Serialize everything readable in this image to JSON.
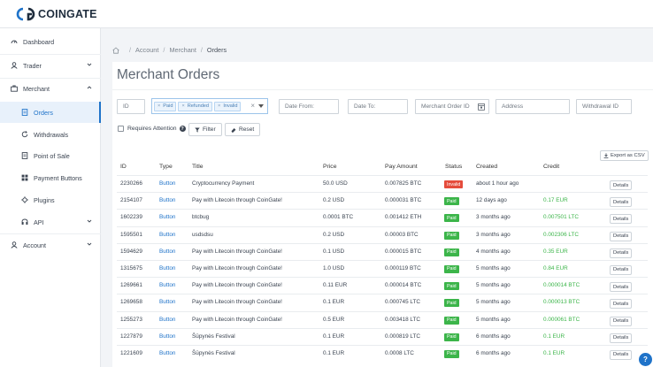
{
  "brand": {
    "name": "COINGATE",
    "accent": "#1f73c9",
    "paid_color": "#3cb54a",
    "invalid_color": "#e54c3c"
  },
  "sidebar": {
    "items": [
      {
        "label": "Dashboard",
        "icon": "gauge-icon"
      },
      {
        "label": "Trader",
        "icon": "user-icon",
        "chevron": "down"
      },
      {
        "label": "Merchant",
        "icon": "briefcase-icon",
        "chevron": "up"
      },
      {
        "label": "Orders",
        "icon": "document-icon",
        "active": true
      },
      {
        "label": "Withdrawals",
        "icon": "refresh-icon"
      },
      {
        "label": "Point of Sale",
        "icon": "document-icon"
      },
      {
        "label": "Payment Buttons",
        "icon": "grid-icon"
      },
      {
        "label": "Plugins",
        "icon": "plug-icon"
      },
      {
        "label": "API",
        "icon": "api-icon",
        "chevron": "down"
      },
      {
        "label": "Account",
        "icon": "user-icon",
        "chevron": "down"
      }
    ]
  },
  "breadcrumb": {
    "items": [
      "Account",
      "Merchant",
      "Orders"
    ],
    "sep": "/"
  },
  "page": {
    "title": "Merchant Orders"
  },
  "filters": {
    "id_placeholder": "ID",
    "status_tags": [
      "Paid",
      "Refunded",
      "Invalid"
    ],
    "tag_remove": "×",
    "clear": "×",
    "date_from": "Date From:",
    "date_to": "Date To:",
    "merchant_order_id": "Merchant Order ID",
    "address": "Address",
    "withdrawal_id": "Withdrawal ID",
    "requires_attention": "Requires Attention",
    "help_glyph": "?",
    "filter_label": "Filter",
    "reset_label": "Reset",
    "export_label": "Export as CSV"
  },
  "table": {
    "headers": {
      "id": "ID",
      "type": "Type",
      "title": "Title",
      "price": "Price",
      "amount": "Pay Amount",
      "status": "Status",
      "created": "Created",
      "credit": "Credit"
    },
    "details_label": "Details",
    "rows": [
      {
        "id": "2230266",
        "type": "Button",
        "title": "Cryptocurrency Payment",
        "price": "50.0 USD",
        "amount": "0.007825 BTC",
        "status": "Invalid",
        "created": "about 1 hour ago",
        "credit": ""
      },
      {
        "id": "2154107",
        "type": "Button",
        "title": "Pay with Litecoin through CoinGate!",
        "price": "0.2 USD",
        "amount": "0.000031 BTC",
        "status": "Paid",
        "created": "12 days ago",
        "credit": "0.17 EUR"
      },
      {
        "id": "1602239",
        "type": "Button",
        "title": "btcbug",
        "price": "0.0001 BTC",
        "amount": "0.001412 ETH",
        "status": "Paid",
        "created": "3 months ago",
        "credit": "0.007501 LTC"
      },
      {
        "id": "1595501",
        "type": "Button",
        "title": "usdsdsu",
        "price": "0.2 USD",
        "amount": "0.00003 BTC",
        "status": "Paid",
        "created": "3 months ago",
        "credit": "0.002306 LTC"
      },
      {
        "id": "1594629",
        "type": "Button",
        "title": "Pay with Litecoin through CoinGate!",
        "price": "0.1 USD",
        "amount": "0.000015 BTC",
        "status": "Paid",
        "created": "4 months ago",
        "credit": "0.35 EUR"
      },
      {
        "id": "1315675",
        "type": "Button",
        "title": "Pay with Litecoin through CoinGate!",
        "price": "1.0 USD",
        "amount": "0.000119 BTC",
        "status": "Paid",
        "created": "5 months ago",
        "credit": "0.84 EUR"
      },
      {
        "id": "1269661",
        "type": "Button",
        "title": "Pay with Litecoin through CoinGate!",
        "price": "0.11 EUR",
        "amount": "0.000014 BTC",
        "status": "Paid",
        "created": "5 months ago",
        "credit": "0.000014 BTC"
      },
      {
        "id": "1269658",
        "type": "Button",
        "title": "Pay with Litecoin through CoinGate!",
        "price": "0.1 EUR",
        "amount": "0.000745 LTC",
        "status": "Paid",
        "created": "5 months ago",
        "credit": "0.000013 BTC"
      },
      {
        "id": "1255273",
        "type": "Button",
        "title": "Pay with Litecoin through CoinGate!",
        "price": "0.5 EUR",
        "amount": "0.003418 LTC",
        "status": "Paid",
        "created": "5 months ago",
        "credit": "0.000061 BTC"
      },
      {
        "id": "1227879",
        "type": "Button",
        "title": "Šūpynės Festival",
        "price": "0.1 EUR",
        "amount": "0.000819 LTC",
        "status": "Paid",
        "created": "6 months ago",
        "credit": "0.1 EUR"
      },
      {
        "id": "1221609",
        "type": "Button",
        "title": "Šūpynės Festival",
        "price": "0.1 EUR",
        "amount": "0.0008 LTC",
        "status": "Paid",
        "created": "6 months ago",
        "credit": "0.1 EUR"
      }
    ]
  },
  "floating_help": "?"
}
